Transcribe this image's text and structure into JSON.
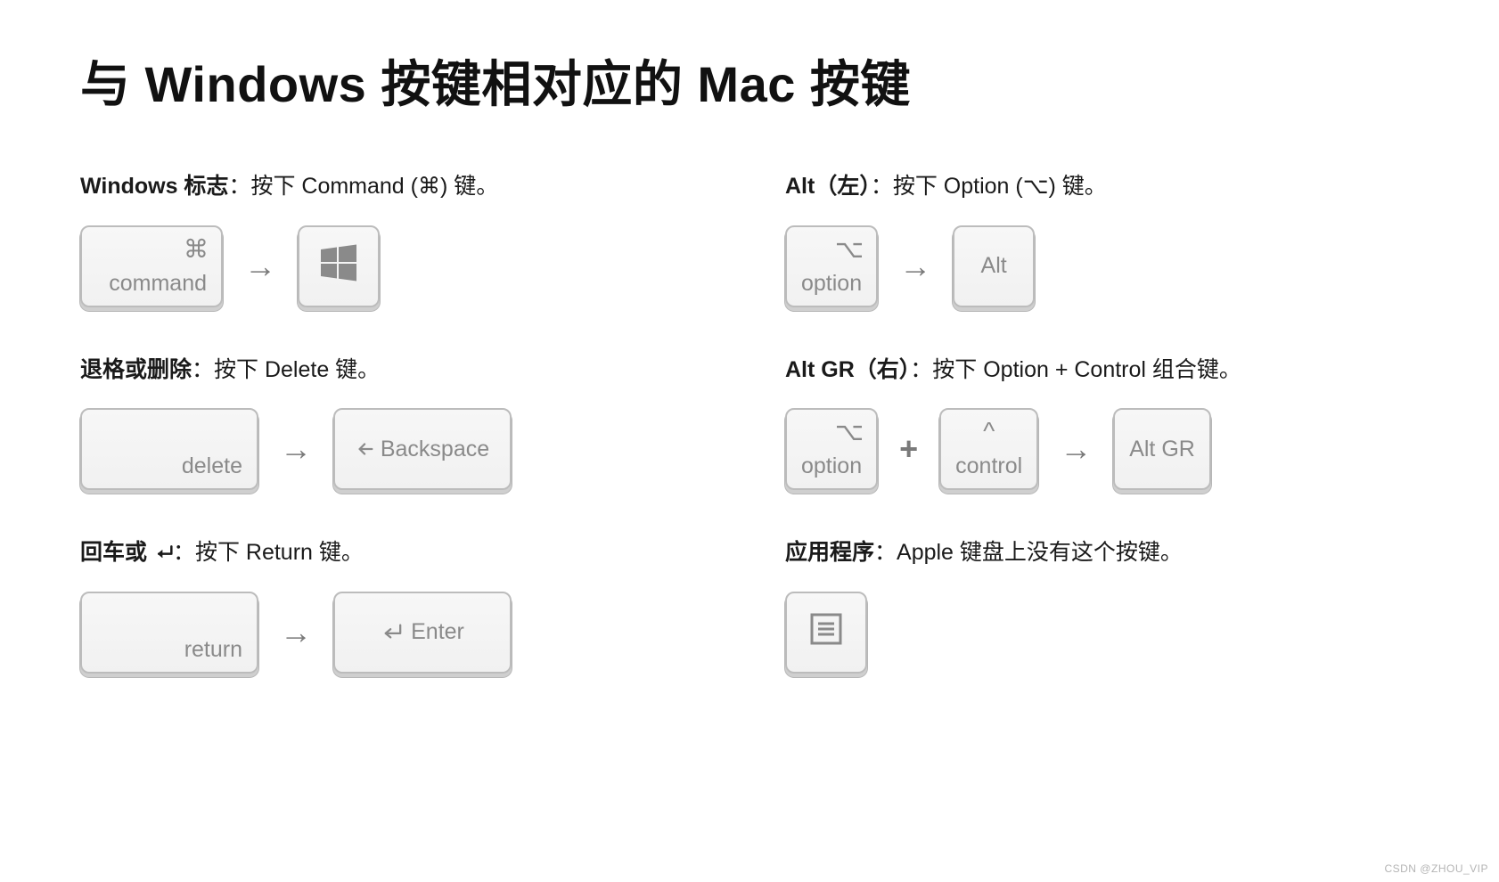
{
  "title": "与 Windows 按键相对应的 Mac 按键",
  "attribution": "CSDN @ZHOU_VIP",
  "left": [
    {
      "label": "Windows 标志",
      "desc": "：按下 Command (⌘) 键。",
      "mac": {
        "symbol": "⌘",
        "text": "command",
        "cls": "mid"
      },
      "op": "→",
      "win": {
        "icon": "windows",
        "cls": "center-content"
      }
    },
    {
      "label": "退格或删除",
      "desc": "：按下 Delete 键。",
      "mac": {
        "text": "delete",
        "cls": "wide"
      },
      "op": "→",
      "win": {
        "text": "Backspace",
        "prefix_icon": "arrow-left",
        "cls": "wide center-content"
      }
    },
    {
      "label": "回车或 ",
      "enter_icon": true,
      "desc": "：按下 Return 键。",
      "mac": {
        "text": "return",
        "cls": "wide"
      },
      "op": "→",
      "win": {
        "text": "Enter",
        "prefix_icon": "enter",
        "cls": "wide center-content"
      }
    }
  ],
  "right": [
    {
      "label": "Alt（左）",
      "desc": "：按下 Option (⌥) 键。",
      "mac": {
        "symbol": "⌥",
        "text": "option"
      },
      "op": "→",
      "win": {
        "text": "Alt",
        "cls": "center-content"
      }
    },
    {
      "label": "Alt GR（右）",
      "desc": "：按下 Option + Control 组合键。",
      "combo": [
        {
          "symbol": "⌥",
          "text": "option"
        },
        {
          "op": "+"
        },
        {
          "symbol": "^",
          "symbol_pos": "topcenter",
          "text": "control",
          "align": "bottom-center"
        }
      ],
      "op": "→",
      "win": {
        "text": "Alt GR",
        "cls": "center-content"
      }
    },
    {
      "label": "应用程序",
      "desc": "：Apple 键盘上没有这个按键。",
      "single": {
        "icon": "menu",
        "cls": "center-content"
      }
    }
  ]
}
